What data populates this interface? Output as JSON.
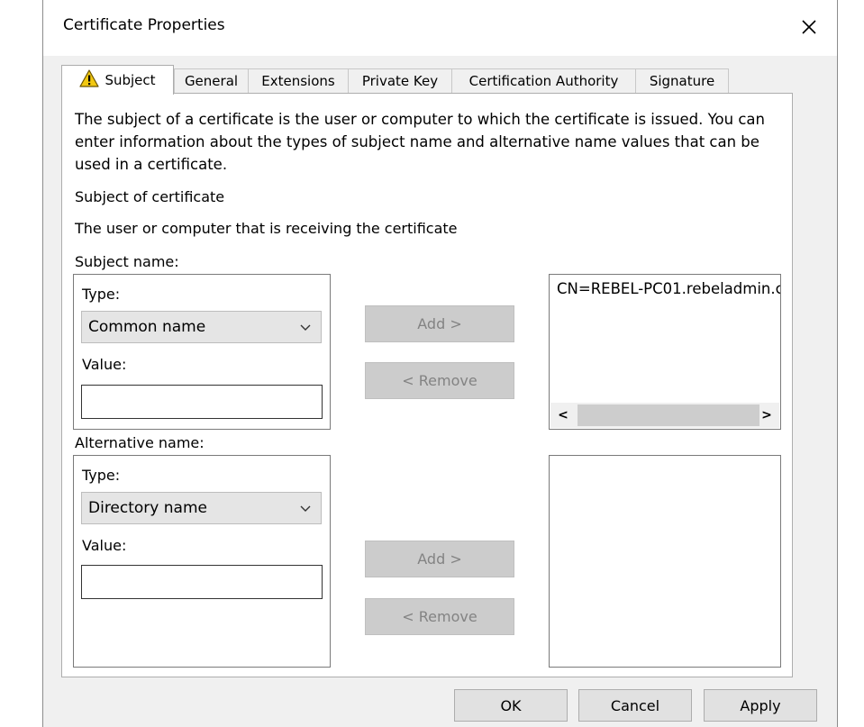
{
  "window": {
    "title": "Certificate Properties"
  },
  "tabs": [
    {
      "label": "Subject",
      "active": true
    },
    {
      "label": "General"
    },
    {
      "label": "Extensions"
    },
    {
      "label": "Private Key"
    },
    {
      "label": "Certification Authority"
    },
    {
      "label": "Signature"
    }
  ],
  "subject_tab": {
    "description": "The subject of a certificate is the user or computer to which the certificate is issued. You can enter information about the types of subject name and alternative name values that can be used in a certificate.",
    "section_title": "Subject of certificate",
    "section_subtitle": "The user or computer that is receiving the certificate",
    "subject_name": {
      "label": "Subject name:",
      "type_label": "Type:",
      "type_value": "Common name",
      "value_label": "Value:",
      "value": ""
    },
    "alternative_name": {
      "label": "Alternative name:",
      "type_label": "Type:",
      "type_value": "Directory name",
      "value_label": "Value:",
      "value": ""
    },
    "add_label": "Add >",
    "remove_label": "< Remove",
    "subject_list": [
      "CN=REBEL-PC01.rebeladmin.c"
    ],
    "alternative_list": []
  },
  "footer": {
    "ok_label": "OK",
    "cancel_label": "Cancel",
    "apply_label": "Apply"
  },
  "colors": {
    "window_bg": "#f0f0f0",
    "disabled_button": "#cccccc",
    "warning_icon": "#f2c811"
  }
}
